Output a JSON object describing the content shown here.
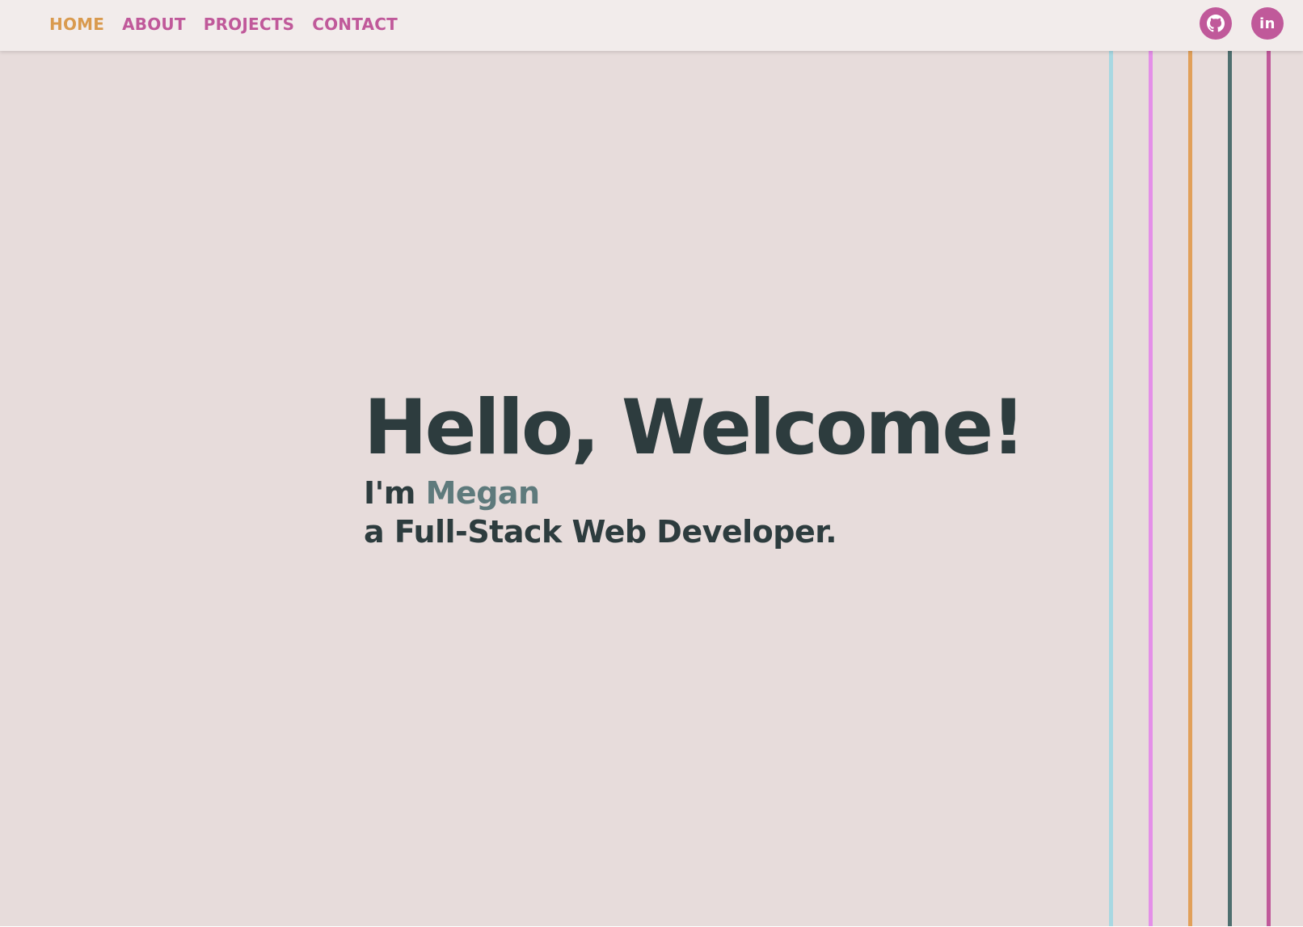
{
  "nav": {
    "links": [
      {
        "label": "HOME",
        "active": true
      },
      {
        "label": "ABOUT",
        "active": false
      },
      {
        "label": "PROJECTS",
        "active": false
      },
      {
        "label": "CONTACT",
        "active": false
      }
    ]
  },
  "social": {
    "github_icon": "github-icon",
    "linkedin_label": "in"
  },
  "hero": {
    "title": "Hello, Welcome!",
    "intro_prefix": "I'm ",
    "name": "Megan",
    "role": "a Full-Stack Web Developer."
  },
  "colors": {
    "background": "#e7dcdb",
    "navbar": "#f2eceb",
    "accent_pink": "#c0599a",
    "accent_orange": "#d99a4e",
    "text_dark": "#2d3c3e",
    "name_teal": "#5e7a7c",
    "stripes": [
      "#a8d8e2",
      "#e48fe8",
      "#e1a05a",
      "#4f6f6f",
      "#c0599a"
    ]
  }
}
